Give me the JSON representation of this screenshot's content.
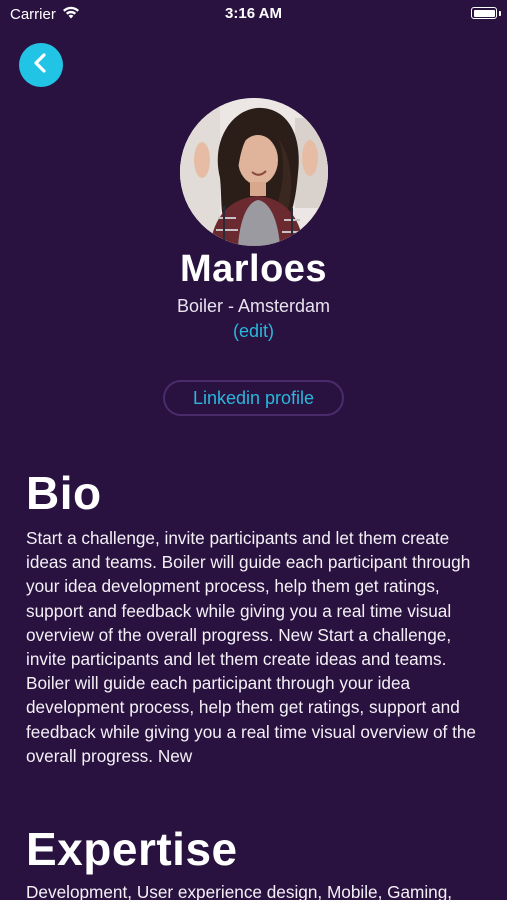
{
  "status_bar": {
    "carrier": "Carrier",
    "time": "3:16 AM"
  },
  "profile": {
    "name": "Marloes",
    "subtitle": "Boiler - Amsterdam",
    "edit_label": "(edit)",
    "linkedin_label": "Linkedin profile"
  },
  "bio": {
    "title": "Bio",
    "text": "Start a challenge, invite participants and let them create ideas and teams. Boiler will guide each participant through your idea development process, help them get ratings, support and feedback while giving you a real time visual overview of the overall progress. New Start a challenge, invite participants and let them create ideas and teams. Boiler will guide each participant through your idea development process, help them get ratings, support and feedback while giving you a real time visual overview of the overall progress. New"
  },
  "expertise": {
    "title": "Expertise",
    "text": "Development, User experience design, Mobile, Gaming,"
  },
  "icons": {
    "back": "chevron-left-icon",
    "wifi": "wifi-icon",
    "battery": "battery-icon"
  },
  "colors": {
    "background": "#2a1240",
    "accent": "#22c4e6",
    "link": "#29b7dc",
    "button_border": "#4a2c6c"
  }
}
